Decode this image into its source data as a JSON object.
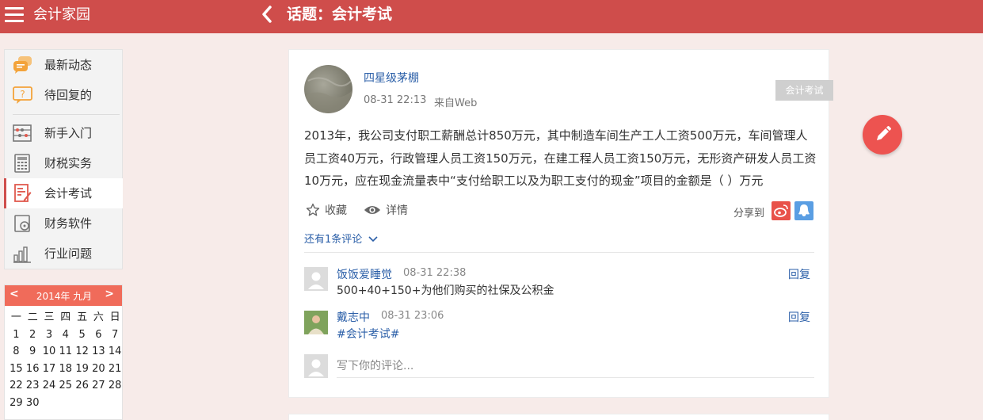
{
  "header": {
    "app_title": "会计家园",
    "page_title": "话题：会计考试"
  },
  "sidebar": {
    "items": [
      {
        "label": "最新动态",
        "icon": "chat-bubbles-icon"
      },
      {
        "label": "待回复的",
        "icon": "question-icon"
      },
      {
        "label": "新手入门",
        "icon": "abacus-icon"
      },
      {
        "label": "财税实务",
        "icon": "calculator-icon"
      },
      {
        "label": "会计考试",
        "icon": "exam-doc-icon",
        "active": true
      },
      {
        "label": "财务软件",
        "icon": "disk-icon"
      },
      {
        "label": "行业问题",
        "icon": "bar-chart-icon"
      }
    ]
  },
  "calendar": {
    "prev": "<",
    "next": ">",
    "title": "2014年 九月",
    "weekdays": [
      "一",
      "二",
      "三",
      "四",
      "五",
      "六",
      "日"
    ],
    "days": [
      "1",
      "2",
      "3",
      "4",
      "5",
      "6",
      "7",
      "8",
      "9",
      "10",
      "11",
      "12",
      "13",
      "14",
      "15",
      "16",
      "17",
      "18",
      "19",
      "20",
      "21",
      "22",
      "23",
      "24",
      "25",
      "26",
      "27",
      "28",
      "29",
      "30"
    ]
  },
  "post": {
    "author": "四星级茅棚",
    "time": "08-31 22:13",
    "source": "来自Web",
    "topic_tag": "会计考试",
    "body": "2013年，我公司支付职工薪酬总计850万元，其中制造车间生产工人工资500万元，车间管理人员工资40万元，行政管理人员工资150万元，在建工程人员工资150万元，无形资产研发人员工资10万元，应在现金流量表中“支付给职工以及为职工支付的现金”项目的金额是（ ）万元",
    "favorite_label": "收藏",
    "detail_label": "详情",
    "share_label": "分享到",
    "more_comments": "还有1条评论",
    "comments": [
      {
        "name": "饭饭爱睡觉",
        "time": "08-31 22:38",
        "text": "500+40+150+为他们购买的社保及公积金",
        "reply": "回复"
      },
      {
        "name": "戴志中",
        "time": "08-31 23:06",
        "text": "#会计考试#",
        "reply": "回复"
      }
    ],
    "comment_placeholder": "写下你的评论..."
  },
  "colors": {
    "brand": "#cf4d4b",
    "link": "#2b5fa8",
    "fab": "#ed5350"
  }
}
